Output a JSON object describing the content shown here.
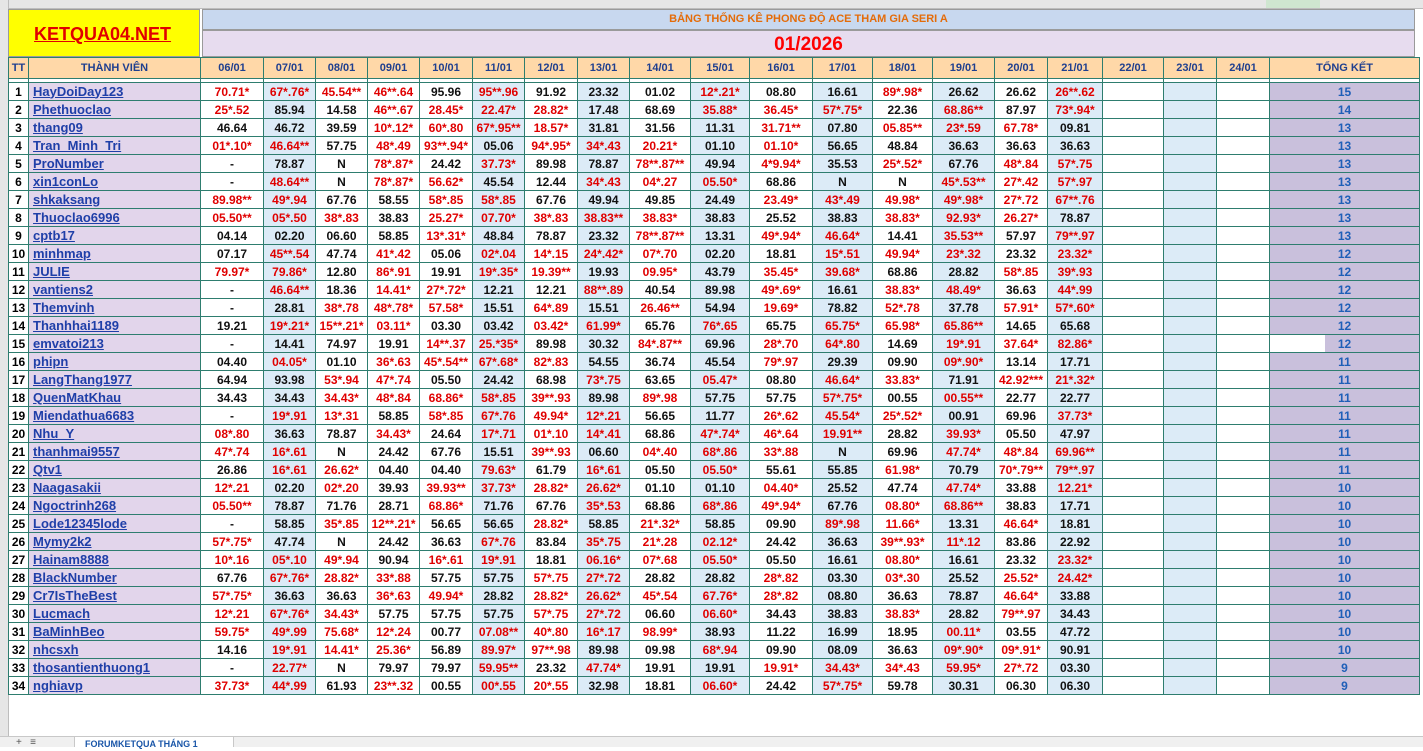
{
  "site": "KETQUA04.NET",
  "title": "BẢNG THỐNG KÊ PHONG ĐỘ ACE THAM GIA SERI A",
  "month": "01/2026",
  "headers": {
    "tt": "TT",
    "member": "THÀNH VIÊN",
    "dates": [
      "06/01",
      "07/01",
      "08/01",
      "09/01",
      "10/01",
      "11/01",
      "12/01",
      "13/01",
      "14/01",
      "15/01",
      "16/01",
      "17/01",
      "18/01",
      "19/01",
      "20/01",
      "21/01",
      "22/01",
      "23/01",
      "24/01"
    ],
    "total": "TỔNG KẾT"
  },
  "rows": [
    {
      "tt": "1",
      "name": "HayDoiDay123",
      "cells": [
        "70.71*",
        "67*.76*",
        "45.54**",
        "46**.64",
        "95.96",
        "95**.96",
        "91.92",
        "23.32",
        "01.02",
        "12*.21*",
        "08.80",
        "16.61",
        "89*.98*",
        "26.62",
        "26.62",
        "26**.62"
      ],
      "total": "15"
    },
    {
      "tt": "2",
      "name": "Phethuoclao",
      "cells": [
        "25*.52",
        "85.94",
        "14.58",
        "46**.67",
        "28.45*",
        "22.47*",
        "28.82*",
        "17.48",
        "68.69",
        "35.88*",
        "36.45*",
        "57*.75*",
        "22.36",
        "68.86**",
        "87.97",
        "73*.94*"
      ],
      "total": "14"
    },
    {
      "tt": "3",
      "name": "thang09",
      "cells": [
        "46.64",
        "46.72",
        "39.59",
        "10*.12*",
        "60*.80",
        "67*.95**",
        "18.57*",
        "31.81",
        "31.56",
        "11.31",
        "31.71**",
        "07.80",
        "05.85**",
        "23*.59",
        "67.78*",
        "09.81"
      ],
      "total": "13"
    },
    {
      "tt": "4",
      "name": "Tran_Minh_Tri",
      "cells": [
        "01*.10*",
        "46.64**",
        "57.75",
        "48*.49",
        "93**.94*",
        "05.06",
        "94*.95*",
        "34*.43",
        "20.21*",
        "01.10",
        "01.10*",
        "56.65",
        "48.84",
        "36.63",
        "36.63",
        "36.63"
      ],
      "total": "13"
    },
    {
      "tt": "5",
      "name": "ProNumber",
      "cells": [
        "-",
        "78.87",
        "N",
        "78*.87*",
        "24.42",
        "37.73*",
        "89.98",
        "78.87",
        "78**.87**",
        "49.94",
        "4*9.94*",
        "35.53",
        "25*.52*",
        "67.76",
        "48*.84",
        "57*.75"
      ],
      "total": "13"
    },
    {
      "tt": "6",
      "name": "xin1conLo",
      "cells": [
        "-",
        "48.64**",
        "N",
        "78*.87*",
        "56.62*",
        "45.54",
        "12.44",
        "34*.43",
        "04*.27",
        "05.50*",
        "68.86",
        "N",
        "N",
        "45*.53**",
        "27*.42",
        "57*.97"
      ],
      "total": "13"
    },
    {
      "tt": "7",
      "name": "shkaksang",
      "cells": [
        "89.98**",
        "49*.94",
        "67.76",
        "58.55",
        "58*.85",
        "58*.85",
        "67.76",
        "49.94",
        "49.85",
        "24.49",
        "23.49*",
        "43*.49",
        "49.98*",
        "49*.98*",
        "27*.72",
        "67**.76"
      ],
      "total": "13"
    },
    {
      "tt": "8",
      "name": "Thuoclao6996",
      "cells": [
        "05.50**",
        "05*.50",
        "38*.83",
        "38.83",
        "25.27*",
        "07.70*",
        "38*.83",
        "38.83**",
        "38.83*",
        "38.83",
        "25.52",
        "38.83",
        "38.83*",
        "92.93*",
        "26.27*",
        "78.87"
      ],
      "total": "13"
    },
    {
      "tt": "9",
      "name": "cptb17",
      "cells": [
        "04.14",
        "02.20",
        "06.60",
        "58.85",
        "13*.31*",
        "48.84",
        "78.87",
        "23.32",
        "78**.87**",
        "13.31",
        "49*.94*",
        "46.64*",
        "14.41",
        "35.53**",
        "57.97",
        "79**.97"
      ],
      "total": "13"
    },
    {
      "tt": "10",
      "name": "minhmap",
      "cells": [
        "07.17",
        "45**.54",
        "47.74",
        "41*.42",
        "05.06",
        "02*.04",
        "14*.15",
        "24*.42*",
        "07*.70",
        "02.20",
        "18.81",
        "15*.51",
        "49.94*",
        "23*.32",
        "23.32",
        "23.32*"
      ],
      "total": "12"
    },
    {
      "tt": "11",
      "name": "JULIE",
      "cells": [
        "79.97*",
        "79.86*",
        "12.80",
        "86*.91",
        "19.91",
        "19*.35*",
        "19.39**",
        "19.93",
        "09.95*",
        "43.79",
        "35.45*",
        "39.68*",
        "68.86",
        "28.82",
        "58*.85",
        "39*.93"
      ],
      "total": "12"
    },
    {
      "tt": "12",
      "name": "vantiens2",
      "cells": [
        "-",
        "46.64**",
        "18.36",
        "14.41*",
        "27*.72*",
        "12.21",
        "12.21",
        "88**.89",
        "40.54",
        "89.98",
        "49*.69*",
        "16.61",
        "38.83*",
        "48.49*",
        "36.63",
        "44*.99"
      ],
      "total": "12"
    },
    {
      "tt": "13",
      "name": "Themvinh",
      "cells": [
        "-",
        "28.81",
        "38*.78",
        "48*.78*",
        "57.58*",
        "15.51",
        "64*.89",
        "15.51",
        "26.46**",
        "54.94",
        "19.69*",
        "78.82",
        "52*.78",
        "37.78",
        "57.91*",
        "57*.60*"
      ],
      "total": "12"
    },
    {
      "tt": "14",
      "name": "Thanhhai1189",
      "cells": [
        "19.21",
        "19*.21*",
        "15**.21*",
        "03.11*",
        "03.30",
        "03.42",
        "03.42*",
        "61.99*",
        "65.76",
        "76*.65",
        "65.75",
        "65.75*",
        "65.98*",
        "65.86**",
        "14.65",
        "65.68"
      ],
      "total": "12"
    },
    {
      "tt": "15",
      "name": "emvatoi213",
      "cells": [
        "-",
        "14.41",
        "74.97",
        "19.91",
        "14**.37",
        "25.*35*",
        "89.98",
        "30.32",
        "84*.87**",
        "69.96",
        "28*.70",
        "64*.80",
        "14.69",
        "19*.91",
        "37.64*",
        "82.86*"
      ],
      "total": "12"
    },
    {
      "tt": "16",
      "name": "phipn",
      "cells": [
        "04.40",
        "04.05*",
        "01.10",
        "36*.63",
        "45*.54**",
        "67*.68*",
        "82*.83",
        "54.55",
        "36.74",
        "45.54",
        "79*.97",
        "29.39",
        "09.90",
        "09*.90*",
        "13.14",
        "17.71"
      ],
      "total": "11"
    },
    {
      "tt": "17",
      "name": "LangThang1977",
      "cells": [
        "64.94",
        "93.98",
        "53*.94",
        "47*.74",
        "05.50",
        "24.42",
        "68.98",
        "73*.75",
        "63.65",
        "05.47*",
        "08.80",
        "46.64*",
        "33.83*",
        "71.91",
        "42.92***",
        "21*.32*"
      ],
      "total": "11"
    },
    {
      "tt": "18",
      "name": "QuenMatKhau",
      "cells": [
        "34.43",
        "34.43",
        "34.43*",
        "48*.84",
        "68.86*",
        "58*.85",
        "39**.93",
        "89.98",
        "89*.98",
        "57.75",
        "57.75",
        "57*.75*",
        "00.55",
        "00.55**",
        "22.77",
        "22.77"
      ],
      "total": "11"
    },
    {
      "tt": "19",
      "name": "Miendathua6683",
      "cells": [
        "-",
        "19*.91",
        "13*.31",
        "58.85",
        "58*.85",
        "67*.76",
        "49.94*",
        "12*.21",
        "56.65",
        "11.77",
        "26*.62",
        "45.54*",
        "25*.52*",
        "00.91",
        "69.96",
        "37.73*"
      ],
      "total": "11"
    },
    {
      "tt": "20",
      "name": "Nhu_Y",
      "cells": [
        "08*.80",
        "36.63",
        "78.87",
        "34.43*",
        "24.64",
        "17*.71",
        "01*.10",
        "14*.41",
        "68.86",
        "47*.74*",
        "46*.64",
        "19.91**",
        "28.82",
        "39.93*",
        "05.50",
        "47.97"
      ],
      "total": "11"
    },
    {
      "tt": "21",
      "name": "thanhmai9557",
      "cells": [
        "47*.74",
        "16*.61",
        "N",
        "24.42",
        "67.76",
        "15.51",
        "39**.93",
        "06.60",
        "04*.40",
        "68*.86",
        "33*.88",
        "N",
        "69.96",
        "47.74*",
        "48*.84",
        "69.96**"
      ],
      "total": "11"
    },
    {
      "tt": "22",
      "name": "Qtv1",
      "cells": [
        "26.86",
        "16*.61",
        "26.62*",
        "04.40",
        "04.40",
        "79.63*",
        "61.79",
        "16*.61",
        "05.50",
        "05.50*",
        "55.61",
        "55.85",
        "61.98*",
        "70.79",
        "70*.79**",
        "79**.97"
      ],
      "total": "11"
    },
    {
      "tt": "23",
      "name": "Naagasakii",
      "cells": [
        "12*.21",
        "02.20",
        "02*.20",
        "39.93",
        "39.93**",
        "37.73*",
        "28.82*",
        "26.62*",
        "01.10",
        "01.10",
        "04.40*",
        "25.52",
        "47.74",
        "47.74*",
        "33.88",
        "12.21*"
      ],
      "total": "10"
    },
    {
      "tt": "24",
      "name": "Ngoctrinh268",
      "cells": [
        "05.50**",
        "78.87",
        "71.76",
        "28.71",
        "68.86*",
        "71.76",
        "67.76",
        "35*.53",
        "68.86",
        "68*.86",
        "49*.94*",
        "67.76",
        "08.80*",
        "68.86**",
        "38.83",
        "17.71"
      ],
      "total": "10"
    },
    {
      "tt": "25",
      "name": "Lode12345lode",
      "cells": [
        "-",
        "58.85",
        "35*.85",
        "12**.21*",
        "56.65",
        "56.65",
        "28.82*",
        "58.85",
        "21*.32*",
        "58.85",
        "09.90",
        "89*.98",
        "11.66*",
        "13.31",
        "46.64*",
        "18.81"
      ],
      "total": "10"
    },
    {
      "tt": "26",
      "name": "Mymy2k2",
      "cells": [
        "57*.75*",
        "47.74",
        "N",
        "24.42",
        "36.63",
        "67*.76",
        "83.84",
        "35*.75",
        "21*.28",
        "02.12*",
        "24.42",
        "36.63",
        "39**.93*",
        "11*.12",
        "83.86",
        "22.92"
      ],
      "total": "10"
    },
    {
      "tt": "27",
      "name": "Hainam8888",
      "cells": [
        "10*.16",
        "05*.10",
        "49*.94",
        "90.94",
        "16*.61",
        "19*.91",
        "18.81",
        "06.16*",
        "07*.68",
        "05.50*",
        "05.50",
        "16.61",
        "08.80*",
        "16.61",
        "23.32",
        "23.32*"
      ],
      "total": "10"
    },
    {
      "tt": "28",
      "name": "BlackNumber",
      "cells": [
        "67.76",
        "67*.76*",
        "28.82*",
        "33*.88",
        "57.75",
        "57.75",
        "57*.75",
        "27*.72",
        "28.82",
        "28.82",
        "28*.82",
        "03.30",
        "03*.30",
        "25.52",
        "25.52*",
        "24.42*"
      ],
      "total": "10"
    },
    {
      "tt": "29",
      "name": "Cr7IsTheBest",
      "cells": [
        "57*.75*",
        "36.63",
        "36.63",
        "36*.63",
        "49.94*",
        "28.82",
        "28.82*",
        "26.62*",
        "45*.54",
        "67.76*",
        "28*.82",
        "08.80",
        "36.63",
        "78.87",
        "46.64*",
        "33.88"
      ],
      "total": "10"
    },
    {
      "tt": "30",
      "name": "Lucmach",
      "cells": [
        "12*.21",
        "67*.76*",
        "34.43*",
        "57.75",
        "57.75",
        "57.75",
        "57*.75",
        "27*.72",
        "06.60",
        "06.60*",
        "34.43",
        "38.83",
        "38.83*",
        "28.82",
        "79**.97",
        "34.43"
      ],
      "total": "10"
    },
    {
      "tt": "31",
      "name": "BaMinhBeo",
      "cells": [
        "59.75*",
        "49*.99",
        "75.68*",
        "12*.24",
        "00.77",
        "07.08**",
        "40*.80",
        "16*.17",
        "98.99*",
        "38.93",
        "11.22",
        "16.99",
        "18.95",
        "00.11*",
        "03.55",
        "47.72"
      ],
      "total": "10"
    },
    {
      "tt": "32",
      "name": "nhcsxh",
      "cells": [
        "14.16",
        "19*.91",
        "14.41*",
        "25.36*",
        "56.89",
        "89.97*",
        "97**.98",
        "89.98",
        "09.98",
        "68*.94",
        "09.90",
        "08.09",
        "36.63",
        "09*.90*",
        "09*.91*",
        "90.91"
      ],
      "total": "10"
    },
    {
      "tt": "33",
      "name": "thosantienthuong1",
      "cells": [
        "-",
        "22.77*",
        "N",
        "79.97",
        "79.97",
        "59.95**",
        "23.32",
        "47.74*",
        "19.91",
        "19.91",
        "19.91*",
        "34.43*",
        "34*.43",
        "59.95*",
        "27*.72",
        "03.30"
      ],
      "total": "9"
    },
    {
      "tt": "34",
      "name": "nghiavp",
      "cells": [
        "37.73*",
        "44*.99",
        "61.93",
        "23**.32",
        "00.55",
        "00*.55",
        "20*.55",
        "32.98",
        "18.81",
        "06.60*",
        "24.42",
        "57*.75*",
        "59.78",
        "30.31",
        "06.30",
        "06.30"
      ],
      "total": "9"
    }
  ],
  "sheet_tab": "FORUMKETQUA THÁNG 1"
}
